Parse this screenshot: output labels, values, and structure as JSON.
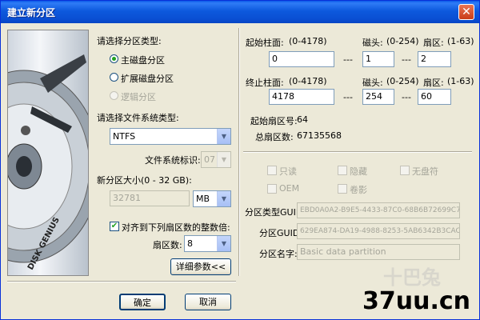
{
  "window": {
    "title": "建立新分区",
    "close_glyph": "✕"
  },
  "left_image": {
    "brand_text": "DISK GENIUS"
  },
  "partition_type": {
    "label": "请选择分区类型:",
    "options": [
      {
        "label": "主磁盘分区",
        "selected": true,
        "enabled": true
      },
      {
        "label": "扩展磁盘分区",
        "selected": false,
        "enabled": true
      },
      {
        "label": "逻辑分区",
        "selected": false,
        "enabled": false
      }
    ]
  },
  "fs_type": {
    "label": "请选择文件系统类型:",
    "value": "NTFS"
  },
  "fs_id": {
    "label": "文件系统标识:",
    "value": "07"
  },
  "size": {
    "label": "新分区大小(0 - 32 GB):",
    "value": "32781",
    "unit": "MB"
  },
  "align": {
    "label": "对齐到下列扇区数的整数倍:",
    "checked": true,
    "sectors_label": "扇区数:",
    "sectors_value": "8"
  },
  "details_button": "详细参数<<",
  "start_chs": {
    "cyl_label": "起始柱面:",
    "cyl_range": "(0-4178)",
    "cyl_value": "0",
    "head_label": "磁头:",
    "head_range": "(0-254)",
    "head_value": "1",
    "sec_label": "扇区:",
    "sec_range": "(1-63)",
    "sec_value": "2"
  },
  "end_chs": {
    "cyl_label": "终止柱面:",
    "cyl_range": "(0-4178)",
    "cyl_value": "4178",
    "head_label": "磁头:",
    "head_range": "(0-254)",
    "head_value": "254",
    "sec_label": "扇区:",
    "sec_range": "(1-63)",
    "sec_value": "60"
  },
  "dash": "---",
  "start_sector": {
    "label": "起始扇区号:",
    "value": "64"
  },
  "total_sectors": {
    "label": "总扇区数:",
    "value": "67135568"
  },
  "attributes": [
    {
      "label": "只读"
    },
    {
      "label": "隐藏"
    },
    {
      "label": "无盘符"
    },
    {
      "label": "OEM"
    },
    {
      "label": "卷影"
    }
  ],
  "guid_type": {
    "label": "分区类型GUID:",
    "value": "EBD0A0A2-B9E5-4433-87C0-68B6B72699C7"
  },
  "guid_part": {
    "label": "分区GUID:",
    "value": "629EA874-DA19-4988-8253-5AB6342B3CAC"
  },
  "part_name": {
    "label": "分区名字:",
    "value": "Basic data partition"
  },
  "ok_button": "确定",
  "cancel_button": "取消",
  "watermark": {
    "logo_text": "十巴兔",
    "site_text": "37uu.cn"
  }
}
